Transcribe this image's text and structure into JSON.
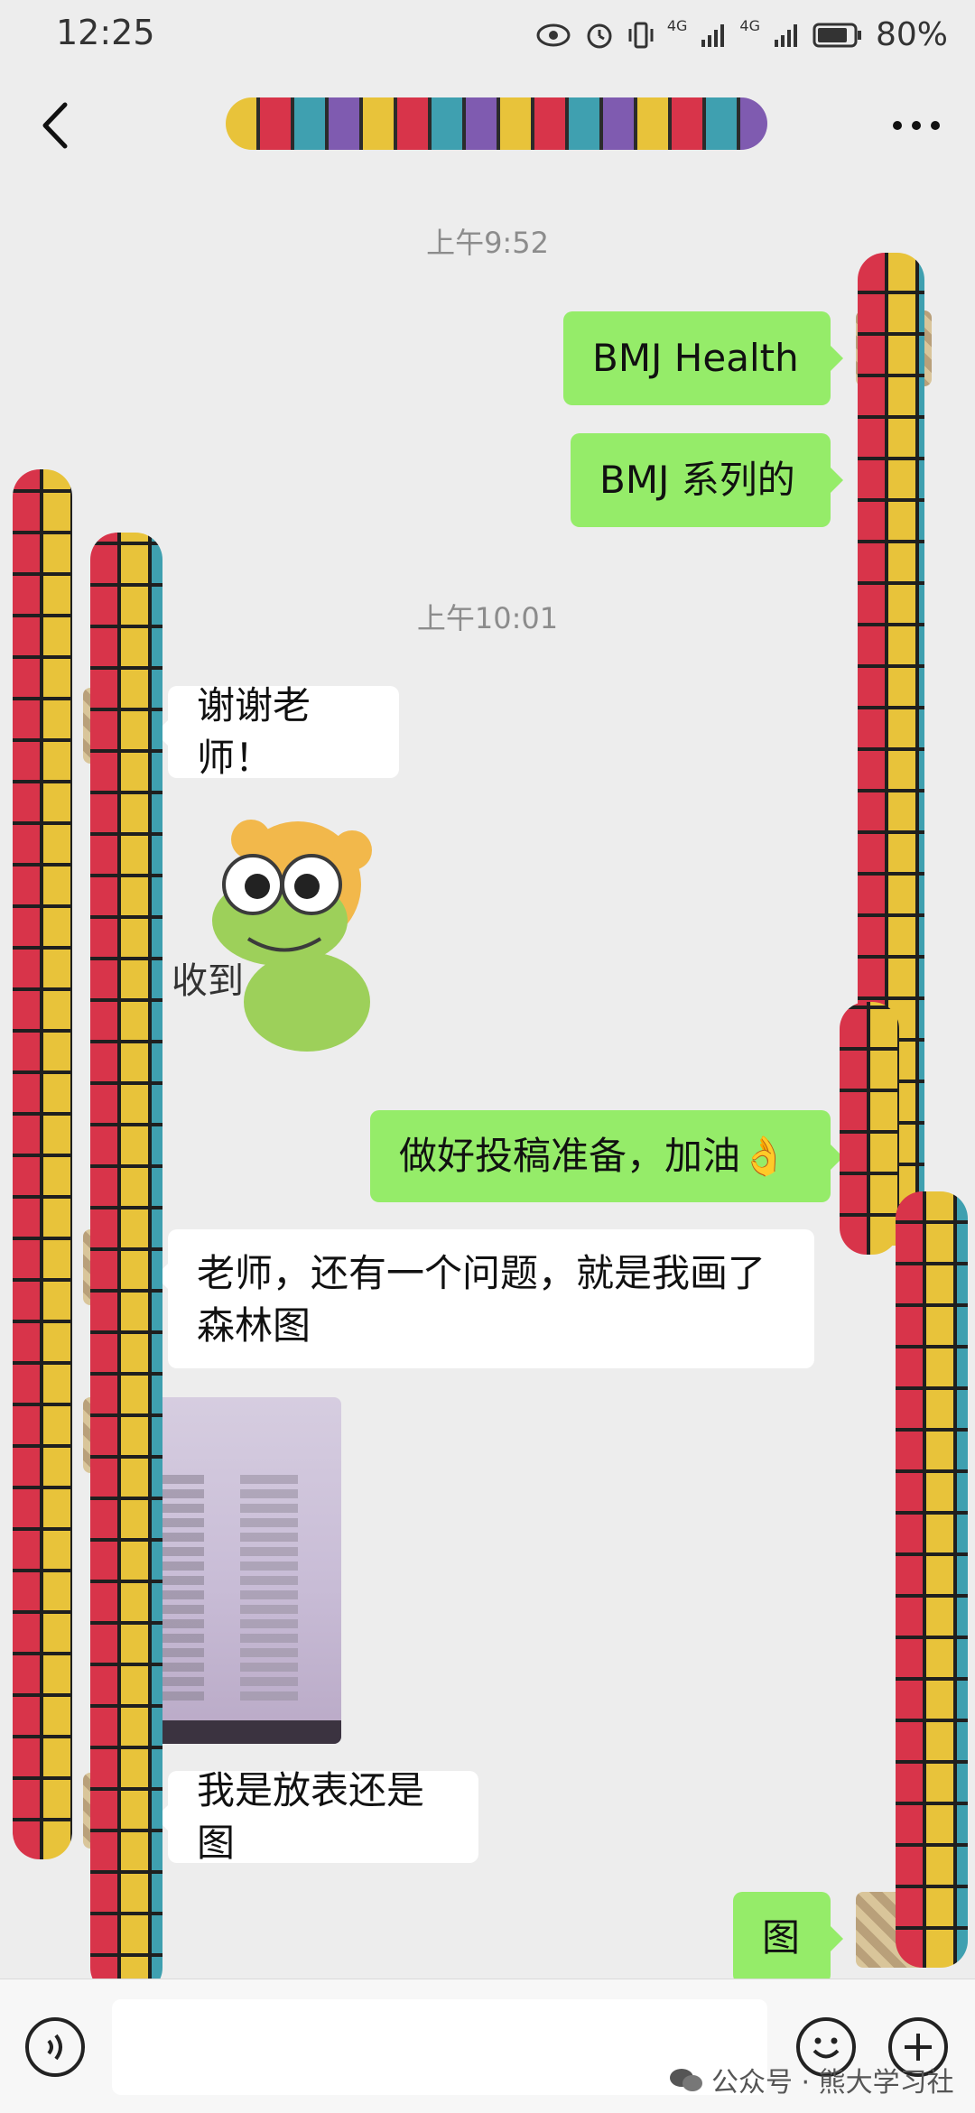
{
  "status_bar": {
    "time": "12:25",
    "battery": "80%",
    "network_1": "4G",
    "network_2": "4G"
  },
  "header": {
    "title": "",
    "back_icon": "chevron-left-icon",
    "more_icon": "more-dots-icon"
  },
  "timestamps": [
    "上午9:52",
    "上午10:01"
  ],
  "messages": {
    "m1": "BMJ Health",
    "m2": "BMJ 系列的",
    "m3": "谢谢老师！",
    "m4_sticker": "收到",
    "m5": "做好投稿准备，加油👌",
    "m6": "老师，还有一个问题，就是我画了森林图",
    "m8": "我是放表还是图",
    "m9": "图"
  },
  "input": {
    "placeholder": ""
  },
  "watermark": "公众号 · 熊大学习社",
  "colors": {
    "background": "#ededed",
    "me_bubble": "#95ec69",
    "other_bubble": "#ffffff"
  }
}
